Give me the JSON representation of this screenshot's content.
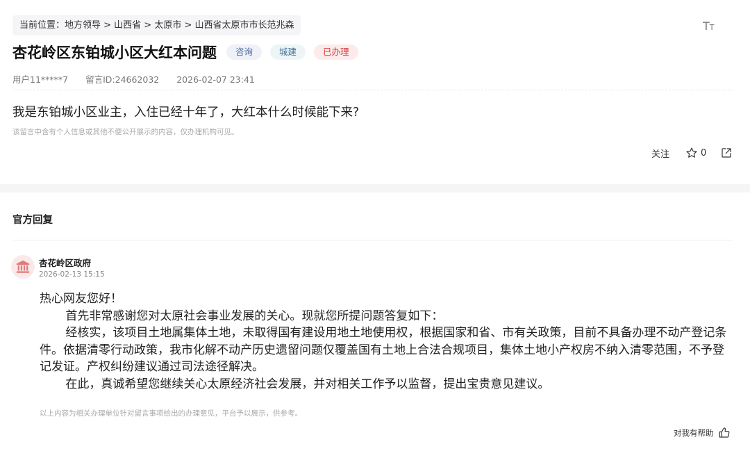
{
  "breadcrumb": {
    "text": "当前位置：地方领导 > 山西省 > 太原市 > 山西省太原市市长范兆森"
  },
  "font_toggle": {
    "big": "T",
    "small": "T"
  },
  "post": {
    "title": "杏花岭区东铂城小区大红本问题",
    "tags": [
      "咨询",
      "城建",
      "已办理"
    ],
    "user": "用户11*****7",
    "message_id": "留言ID:24662032",
    "datetime": "2026-02-07 23:41",
    "question": "我是东铂城小区业主，入住已经十年了，大红本什么时候能下来?",
    "privacy_note": "该留言中含有个人信息或其他不便公开展示的内容，仅办理机构可见。"
  },
  "actions": {
    "follow_label": "关注",
    "star_count": "0"
  },
  "reply_section": {
    "title": "官方回复",
    "org_name": "杏花岭区政府",
    "date": "2026-02-13 15:15",
    "greeting": "热心网友您好！",
    "paragraphs": [
      "首先非常感谢您对太原社会事业发展的关心。现就您所提问题答复如下：",
      "经核实，该项目土地属集体土地，未取得国有建设用地土地使用权，根据国家和省、市有关政策，目前不具备办理不动产登记条件。依据清零行动政策，我市化解不动产历史遗留问题仅覆盖国有土地上合法合规项目，集体土地小产权房不纳入清零范围，不予登记发证。产权纠纷建议通过司法途径解决。",
      "在此，真诚希望您继续关心太原经济社会发展，并对相关工作予以监督，提出宝贵意见建议。"
    ],
    "disclaimer": "以上内容为相关办理单位针对留言事项给出的办理意见，平台予以展示，供参考。",
    "helpful_label": "对我有帮助"
  },
  "icons": {
    "star": "star-icon",
    "share": "share-icon",
    "avatar": "government-building-icon",
    "thumb": "thumbs-up-icon",
    "font_size": "font-size-icon"
  },
  "colors": {
    "tag_done": "#d43a3a",
    "tag_consult": "#4e6c9e",
    "avatar_bg": "#fbe9e9",
    "avatar_fg": "#e07b7b"
  }
}
